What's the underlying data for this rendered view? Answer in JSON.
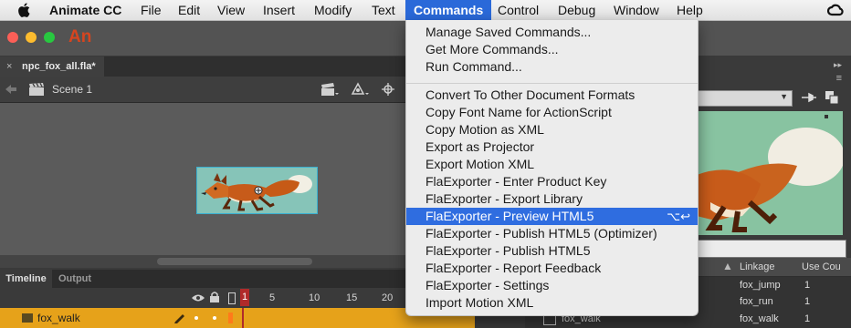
{
  "menubar": {
    "app_name": "Animate CC",
    "items": [
      "File",
      "Edit",
      "View",
      "Insert",
      "Modify",
      "Text",
      "Commands",
      "Control",
      "Debug",
      "Window",
      "Help"
    ],
    "active": "Commands"
  },
  "app": {
    "logo": "An"
  },
  "document": {
    "tab_label": "npc_fox_all.fla*",
    "close_glyph": "×",
    "scene": "Scene 1"
  },
  "timeline": {
    "tabs": [
      "Timeline",
      "Output"
    ],
    "frame_numbers": [
      "1",
      "5",
      "10",
      "15",
      "20"
    ],
    "layer_name": "fox_walk"
  },
  "commands_menu": {
    "group1": [
      "Manage Saved Commands...",
      "Get More Commands...",
      "Run Command..."
    ],
    "group2": [
      "Convert To Other Document Formats",
      "Copy Font Name for ActionScript",
      "Copy Motion as XML",
      "Export as Projector",
      "Export Motion XML",
      "FlaExporter - Enter Product Key",
      "FlaExporter - Export Library",
      "FlaExporter - Preview HTML5",
      "FlaExporter - Publish HTML5 (Optimizer)",
      "FlaExporter - Publish HTML5",
      "FlaExporter - Report Feedback",
      "FlaExporter - Settings",
      "Import Motion XML"
    ],
    "highlighted_index": 7,
    "highlighted_shortcut": "⌥↩"
  },
  "library": {
    "columns": [
      "Linkage",
      "Use Cou"
    ],
    "rows": [
      {
        "linkage": "fox_jump",
        "use_count": "1"
      },
      {
        "linkage": "fox_run",
        "use_count": "1"
      },
      {
        "name": "fox_walk",
        "linkage": "fox_walk",
        "use_count": "1"
      }
    ]
  },
  "colors": {
    "menu_highlight": "#2f6de0",
    "timeline_layer": "#e6a21a",
    "preview_bg": "#88c3a1",
    "stage_fill": "#86c4b8"
  }
}
